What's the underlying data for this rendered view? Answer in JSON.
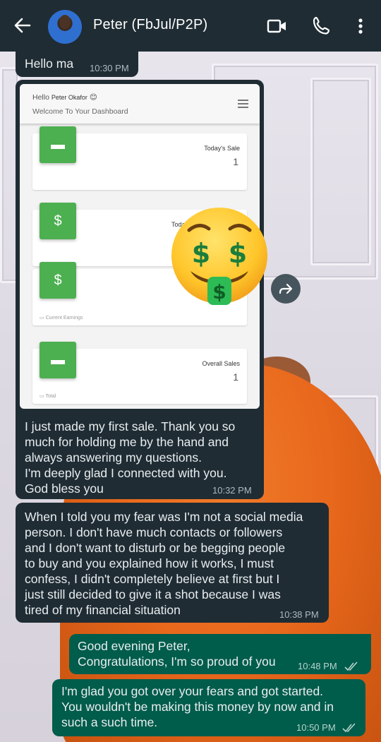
{
  "header": {
    "title": "Peter (FbJul/P2P)",
    "icons": [
      "back-arrow-icon",
      "video-call-icon",
      "phone-icon",
      "more-vertical-icon"
    ]
  },
  "colors": {
    "header_bg": "#1f2c34",
    "incoming_bubble": "#1f2c34",
    "outgoing_bubble": "#005c4b",
    "dashboard_green": "#4caf50"
  },
  "messages": [
    {
      "direction": "incoming",
      "text": "Hello ma",
      "time": "10:30 PM"
    },
    {
      "direction": "incoming",
      "type": "image",
      "caption": "I just made my first sale. Thank you so\nmuch for holding me by the hand and\nalways answering my questions.\nI'm deeply glad I connected with you.\nGod bless you",
      "time": "10:32 PM"
    },
    {
      "direction": "incoming",
      "text": "When I told you my fear was I'm not a social media\nperson. I don't have much contacts or followers\nand I don't want to disturb or be begging people\nto buy and you explained how it works, I must\nconfess, I didn't completely believe at first but I\njust still decided to give it a shot because I was\ntired of my financial situation",
      "time": "10:38 PM"
    },
    {
      "direction": "outgoing",
      "text": "Good evening Peter,\nCongratulations, I'm so proud of you",
      "time": "10:48 PM",
      "status": "read"
    },
    {
      "direction": "outgoing",
      "text": "I'm glad you got over your fears and got started.\nYou wouldn't be making this money by now and in\nsuch a such time.",
      "time": "10:50 PM",
      "status": "read"
    }
  ],
  "dashboard": {
    "hello": "Hello",
    "user": "Peter Okafor",
    "welcome": "Welcome To Your Dashboard",
    "cards": [
      {
        "icon": "store-icon",
        "label": "Today's Sale",
        "value": "1",
        "footer": ""
      },
      {
        "icon": "dollar-icon",
        "label": "Today",
        "value": "",
        "footer": ""
      },
      {
        "icon": "dollar-icon",
        "label": "",
        "value": "",
        "footer": "Current Earnings"
      },
      {
        "icon": "store-icon",
        "label": "Overall Sales",
        "value": "1",
        "footer": "Total"
      }
    ]
  },
  "sticker": {
    "icon": "money-mouth-face-emoji"
  },
  "forward": {
    "icon": "forward-icon"
  }
}
